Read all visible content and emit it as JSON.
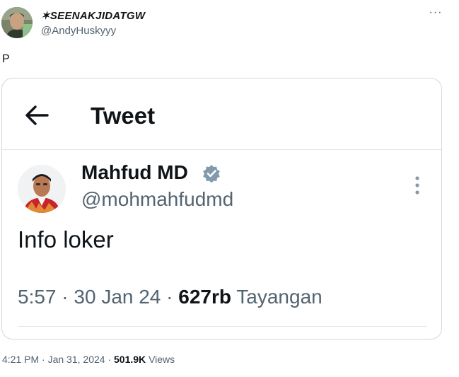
{
  "author": {
    "name": "✶SEENAKJIDATGW",
    "handle": "@AndyHuskyyy",
    "avatar_icon": "user-avatar-photo"
  },
  "more_label": "···",
  "tweet_text": "P",
  "quoted_screenshot": {
    "header_title": "Tweet",
    "back_icon": "arrow-left-icon",
    "name": "Mahfud MD",
    "handle": "@mohmahfudmd",
    "verified_badge_color": "#829aab",
    "text": "Info loker",
    "time": "5:57",
    "date": "30 Jan 24",
    "views_count": "627rb",
    "views_label": "Tayangan",
    "separator": "·"
  },
  "meta": {
    "time": "4:21 PM",
    "date": "Jan 31, 2024",
    "separator": "·",
    "views_count": "501.9K",
    "views_label": "Views"
  },
  "colors": {
    "text_primary": "#0f1419",
    "text_secondary": "#536471",
    "border": "#cfd9de"
  }
}
